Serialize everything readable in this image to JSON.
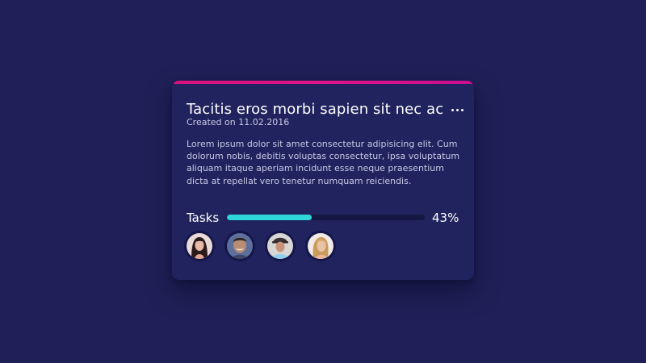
{
  "card": {
    "title": "Tacitis eros morbi sapien sit nec ac",
    "created": "Created on 11.02.2016",
    "description": "Lorem ipsum dolor sit amet consectetur adipisicing elit. Cum dolorum nobis, debitis voluptas consectetur, ipsa voluptatum aliquam itaque aperiam incidunt esse neque praesentium dicta at repellat vero tenetur numquam reiciendis.",
    "more_icon": "more-horizontal-icon",
    "accent_gradient": [
      "#d9117f",
      "#e0148a",
      "#c90f8f"
    ]
  },
  "tasks": {
    "label": "Tasks",
    "percent_label": "43%",
    "progress": 0.43,
    "track_color": "#151743",
    "fill_color": "#2fd8d8"
  },
  "avatars": [
    {
      "icon": "avatar-woman-dark-hair"
    },
    {
      "icon": "avatar-man-smiling"
    },
    {
      "icon": "avatar-man-hat"
    },
    {
      "icon": "avatar-woman-blonde"
    }
  ],
  "colors": {
    "background": "#1f2057",
    "card": "#20235d",
    "accent": "#e0148a"
  }
}
